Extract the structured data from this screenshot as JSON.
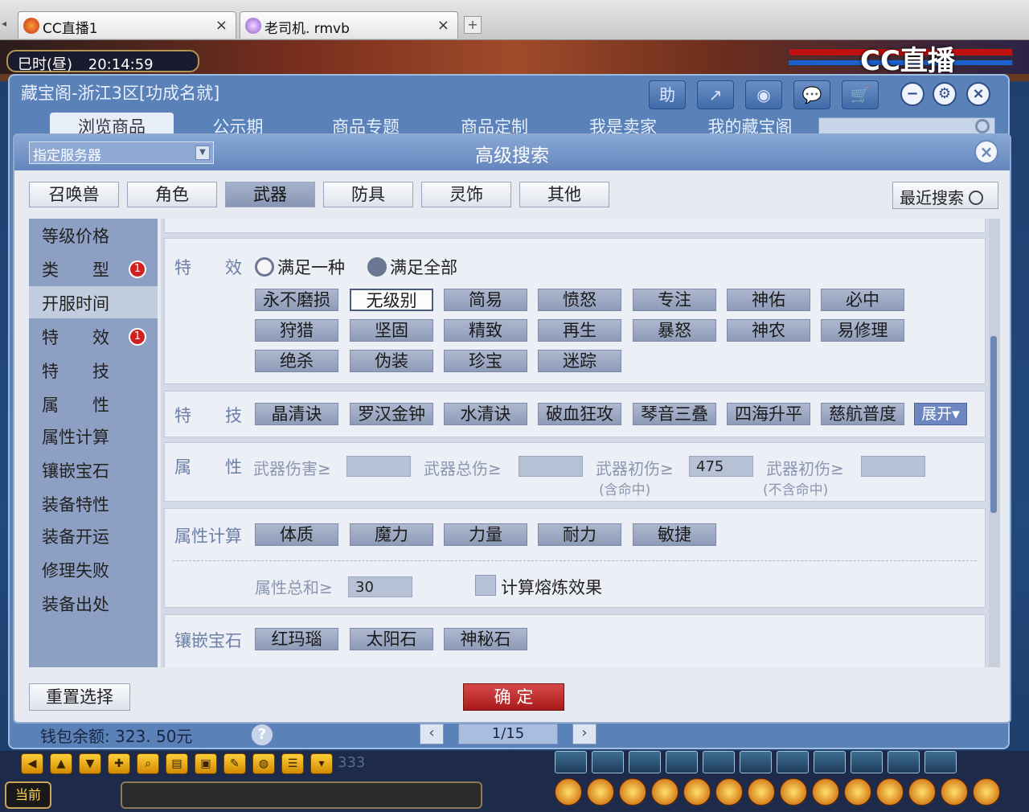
{
  "browser": {
    "tabs": [
      {
        "label": "CC直播1"
      },
      {
        "label": "老司机. rmvb"
      }
    ],
    "close_glyph": "×",
    "add_glyph": "+"
  },
  "game": {
    "clock_label": "巳时(昼)",
    "clock_time": "20:14:59",
    "watermark": "CC直播"
  },
  "store": {
    "title": "藏宝阁-浙江3区[功成名就]",
    "tools": [
      {
        "label": "助",
        "icon": "help-icon"
      },
      {
        "label": "↗",
        "icon": "share-icon"
      },
      {
        "label": "◉",
        "icon": "record-icon"
      },
      {
        "label": "💬",
        "icon": "chat-icon"
      },
      {
        "label": "🛒",
        "icon": "cart-icon"
      }
    ],
    "window_buttons": [
      "−",
      "⚙",
      "×"
    ],
    "nav_tabs": [
      "浏览商品",
      "公示期",
      "商品专题",
      "商品定制",
      "我是卖家",
      "我的藏宝阁"
    ],
    "wallet": "钱包余额: 323. 50元",
    "pager": "1/15"
  },
  "dialog": {
    "title": "高级搜索",
    "server_select": "指定服务器",
    "categories": [
      "召唤兽",
      "角色",
      "武器",
      "防具",
      "灵饰",
      "其他"
    ],
    "active_category": "武器",
    "recent_search": "最近搜索",
    "sidebar": [
      {
        "label": "等级价格"
      },
      {
        "label": "类　　型",
        "badge": "1"
      },
      {
        "label": "开服时间"
      },
      {
        "label": "特　　效",
        "badge": "1"
      },
      {
        "label": "特　　技"
      },
      {
        "label": "属　　性"
      },
      {
        "label": "属性计算"
      },
      {
        "label": "镶嵌宝石"
      },
      {
        "label": "装备特性"
      },
      {
        "label": "装备开运"
      },
      {
        "label": "修理失败"
      },
      {
        "label": "装备出处"
      }
    ],
    "effects": {
      "label": "特　　效",
      "radio_any": "满足一种",
      "radio_all": "满足全部",
      "tags": [
        "永不磨损",
        "无级别",
        "简易",
        "愤怒",
        "专注",
        "神佑",
        "必中",
        "狩猎",
        "坚固",
        "精致",
        "再生",
        "暴怒",
        "神农",
        "易修理",
        "绝杀",
        "伪装",
        "珍宝",
        "迷踪"
      ],
      "selected": "无级别"
    },
    "skills": {
      "label": "特　　技",
      "tags": [
        "晶清诀",
        "罗汉金钟",
        "水清诀",
        "破血狂攻",
        "琴音三叠",
        "四海升平",
        "慈航普度"
      ],
      "expand": "展开▾"
    },
    "attributes": {
      "label": "属　　性",
      "weapon_damage": "武器伤害≥",
      "weapon_total": "武器总伤≥",
      "weapon_init_hit": "武器初伤≥",
      "weapon_init_hit_sub": "(含命中)",
      "weapon_init_hit_value": "475",
      "weapon_init_nohit": "武器初伤≥",
      "weapon_init_nohit_sub": "(不含命中)"
    },
    "attr_calc": {
      "label": "属性计算",
      "tags": [
        "体质",
        "魔力",
        "力量",
        "耐力",
        "敏捷"
      ],
      "sum_label": "属性总和≥",
      "sum_value": "30",
      "smelt_label": "计算熔炼效果"
    },
    "gems": {
      "label": "镶嵌宝石",
      "tags": [
        "红玛瑙",
        "太阳石",
        "神秘石"
      ]
    },
    "reset": "重置选择",
    "confirm": "确 定"
  },
  "hud": {
    "channel": "当前",
    "faded_number": "333"
  }
}
